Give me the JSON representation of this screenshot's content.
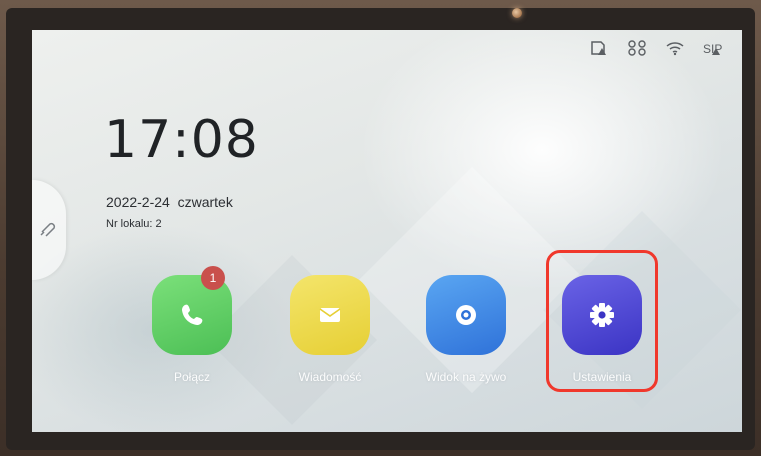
{
  "status_icons": [
    "sd-card-warning-icon",
    "network-disconnected-icon",
    "wifi-icon",
    "sip-warning-icon"
  ],
  "clock": {
    "time": "17:08"
  },
  "date": {
    "text": "2022-2-24  czwartek"
  },
  "unit": {
    "text": "Nr lokalu: 2"
  },
  "apps": [
    {
      "label": "Połącz",
      "icon": "phone-icon",
      "color": "#4cbf55",
      "badge": "1"
    },
    {
      "label": "Wiadomość",
      "icon": "envelope-icon",
      "color": "#e6cf34"
    },
    {
      "label": "Widok na żywo",
      "icon": "camera-lens-icon",
      "color": "#2f72d9"
    },
    {
      "label": "Ustawienia",
      "icon": "gear-icon",
      "color": "#3b34c4"
    }
  ],
  "highlight_color": "#f0382c"
}
